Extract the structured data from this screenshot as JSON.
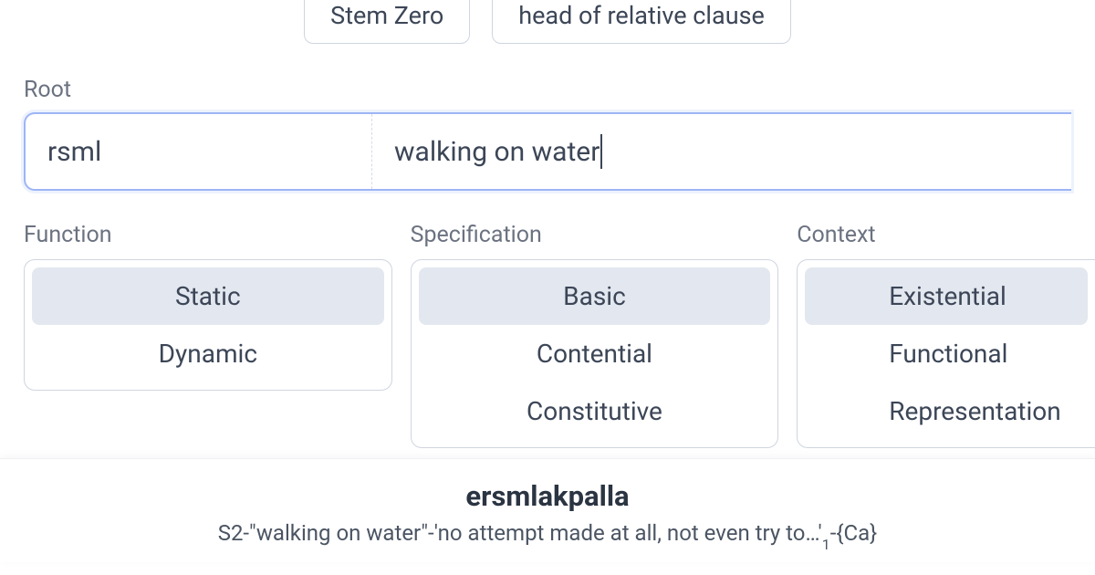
{
  "top_chips": {
    "stem_zero": "Stem Zero",
    "head_relative": "head of relative clause"
  },
  "root": {
    "label": "Root",
    "code": "rsml",
    "gloss": "walking on water"
  },
  "columns": {
    "function": {
      "label": "Function",
      "options": [
        "Static",
        "Dynamic"
      ],
      "selected": 0
    },
    "specification": {
      "label": "Specification",
      "options": [
        "Basic",
        "Contential",
        "Constitutive"
      ],
      "selected": 0
    },
    "context": {
      "label": "Context",
      "options": [
        "Existential",
        "Functional",
        "Representation"
      ],
      "selected": 0
    }
  },
  "result": {
    "word": "ersmlakpalla",
    "gloss_prefix": "S2-\"walking on water\"-'no attempt made at all, not even try to…'",
    "gloss_sub": "1",
    "gloss_suffix": "-{Ca}"
  }
}
